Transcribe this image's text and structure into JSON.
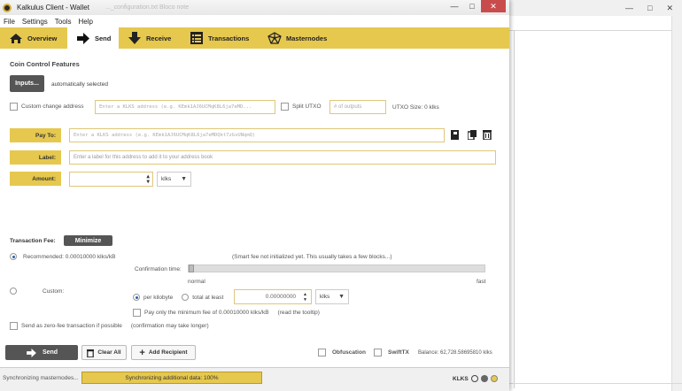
{
  "window": {
    "title": "Kalkulus Client - Wallet",
    "ghost_title": "..._configuration.txt   Bloco note"
  },
  "menu": [
    "File",
    "Settings",
    "Tools",
    "Help"
  ],
  "tabs": [
    {
      "label": "Overview",
      "icon": "home-icon"
    },
    {
      "label": "Send",
      "icon": "arrow-right-icon"
    },
    {
      "label": "Receive",
      "icon": "arrow-down-icon"
    },
    {
      "label": "Transactions",
      "icon": "list-icon"
    },
    {
      "label": "Masternodes",
      "icon": "network-icon"
    }
  ],
  "coin_control": {
    "title": "Coin Control Features",
    "inputs_button": "Inputs...",
    "status": "automatically selected",
    "custom_change_label": "Custom change address",
    "custom_change_placeholder": "Enter a KLKS address (e.g. KEmk1AJ6UCMqK8L6ja7eMD...",
    "split_utxo_label": "Split UTXO",
    "outputs_placeholder": "# of outputs",
    "utxo_size": "UTXO Size:   0 klks"
  },
  "recipient": {
    "pay_to_label": "Pay To:",
    "pay_to_placeholder": "Enter a KLKS address (e.g. KEmk1AJ6UCMqK8L6ja7eMDQkt7zGvUNqmQ)",
    "label_label": "Label:",
    "label_placeholder": "Enter a label for this address to add it to your address book",
    "amount_label": "Amount:",
    "unit": "klks"
  },
  "fee": {
    "title": "Transaction Fee:",
    "minimize": "Minimize",
    "recommended": "Recommended:  0.00010000 klks/kB",
    "smart_fee_note": "(Smart fee not initialized yet. This usually takes a few blocks...)",
    "confirmation_time": "Confirmation time:",
    "normal": "normal",
    "fast": "fast",
    "custom": "Custom:",
    "per_kilobyte": "per kilobyte",
    "total_at_least": "total at least",
    "custom_value": "0.00000000",
    "unit": "klks",
    "min_fee": "Pay only the minimum fee of 0.00010000 klks/kB",
    "read_tooltip": "(read the tooltip)",
    "zero_fee": "Send as zero-fee transaction if possible",
    "zero_fee_note": "(confirmation may take longer)"
  },
  "actions": {
    "send": "Send",
    "clear_all": "Clear All",
    "add_recipient": "Add Recipient",
    "obfuscation": "Obfuscation",
    "swifttx": "SwiftTX",
    "balance": "Balance: 62,728.58695810 klks"
  },
  "status": {
    "left": "Synchronizing masternodes...",
    "progress": "Synchronizing additional data: 100%",
    "progress_value": 1.0,
    "unit": "KLKS"
  },
  "colors": {
    "accent": "#e6c84e",
    "dark_button": "#555555",
    "close": "#c94c4c"
  }
}
